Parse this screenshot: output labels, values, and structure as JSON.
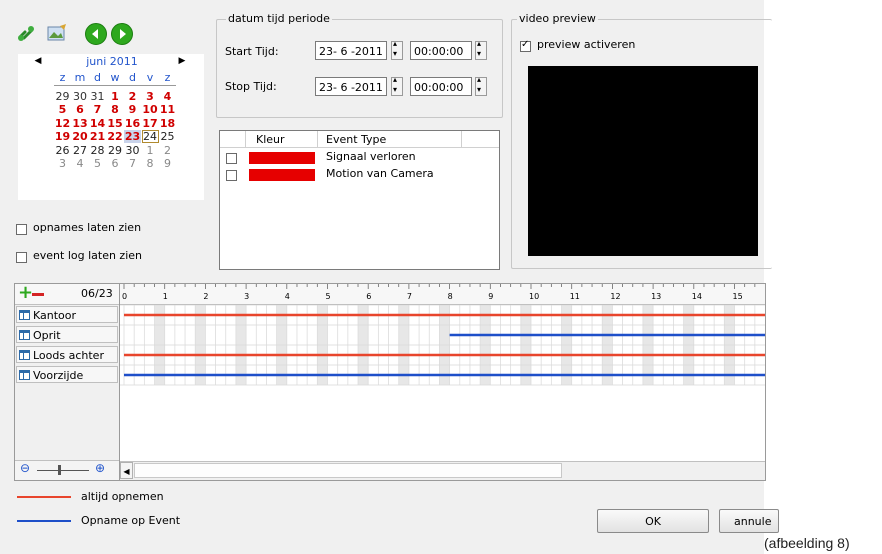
{
  "calendar": {
    "month_label": "juni 2011",
    "weekdays": [
      "z",
      "m",
      "d",
      "w",
      "d",
      "v",
      "z"
    ],
    "rows": [
      [
        "29",
        "30",
        "31",
        "1",
        "2",
        "3",
        "4"
      ],
      [
        "5",
        "6",
        "7",
        "8",
        "9",
        "10",
        "11"
      ],
      [
        "12",
        "13",
        "14",
        "15",
        "16",
        "17",
        "18"
      ],
      [
        "19",
        "20",
        "21",
        "22",
        "23",
        "24",
        "25"
      ],
      [
        "26",
        "27",
        "28",
        "29",
        "30",
        "1",
        "2"
      ],
      [
        "3",
        "4",
        "5",
        "6",
        "7",
        "8",
        "9"
      ]
    ]
  },
  "options": {
    "opnames_label": "opnames laten zien",
    "eventlog_label": "event log laten zien"
  },
  "period": {
    "group_title": "datum tijd periode",
    "start_label": "Start Tijd:",
    "start_date": "23- 6 -2011",
    "start_time": "00:00:00",
    "stop_label": "Stop Tijd:",
    "stop_date": "23- 6 -2011",
    "stop_time": "00:00:00"
  },
  "events": {
    "col_kleur": "Kleur",
    "col_type": "Event Type",
    "rows": [
      {
        "type": "Signaal verloren",
        "color": "#e60000"
      },
      {
        "type": "Motion van Camera",
        "color": "#e60000"
      }
    ]
  },
  "preview": {
    "group_title": "video preview",
    "checkbox_label": "preview activeren"
  },
  "timeline": {
    "date_label": "06/23",
    "hours": [
      "0",
      "1",
      "2",
      "3",
      "4",
      "5",
      "6",
      "7",
      "8",
      "9",
      "10",
      "11",
      "12",
      "13",
      "14",
      "15"
    ],
    "cameras": [
      "Kantoor",
      "Oprit",
      "Loods achter",
      "Voorzijde"
    ]
  },
  "legend": {
    "always_label": "altijd opnemen",
    "event_label": "Opname op Event",
    "always_color": "#e8452c",
    "event_color": "#1e4fc9"
  },
  "buttons": {
    "ok": "OK",
    "cancel": "annule"
  },
  "caption": "(afbeelding 8)"
}
